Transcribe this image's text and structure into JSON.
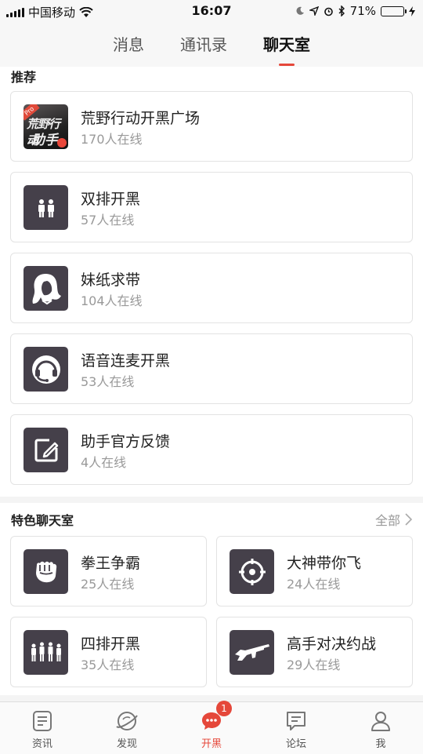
{
  "status_bar": {
    "carrier": "中国移动",
    "time": "16:07",
    "battery_percent": "71%",
    "battery_level": 0.71
  },
  "top_tabs": [
    {
      "label": "消息",
      "active": false
    },
    {
      "label": "通讯录",
      "active": false
    },
    {
      "label": "聊天室",
      "active": true
    }
  ],
  "recommend": {
    "title": "推荐",
    "items": [
      {
        "name": "荒野行动开黑广场",
        "count": "170人在线",
        "icon": "game-logo-icon",
        "logo_text_1": "荒野行动",
        "logo_text_2": "助手",
        "logo_badge": "Pro"
      },
      {
        "name": "双排开黑",
        "count": "57人在线",
        "icon": "two-players-icon"
      },
      {
        "name": "妹纸求带",
        "count": "104人在线",
        "icon": "girl-portrait-icon"
      },
      {
        "name": "语音连麦开黑",
        "count": "53人在线",
        "icon": "headset-icon"
      },
      {
        "name": "助手官方反馈",
        "count": "4人在线",
        "icon": "edit-feedback-icon"
      }
    ]
  },
  "featured": {
    "title": "特色聊天室",
    "more_label": "全部",
    "items": [
      {
        "name": "拳王争霸",
        "count": "25人在线",
        "icon": "fist-icon"
      },
      {
        "name": "大神带你飞",
        "count": "24人在线",
        "icon": "crosshair-icon"
      },
      {
        "name": "四排开黑",
        "count": "35人在线",
        "icon": "four-players-icon"
      },
      {
        "name": "高手对决约战",
        "count": "29人在线",
        "icon": "rifle-icon"
      }
    ]
  },
  "bottom_tabs": [
    {
      "label": "资讯",
      "icon": "news-icon",
      "active": false
    },
    {
      "label": "发现",
      "icon": "planet-icon",
      "active": false
    },
    {
      "label": "开黑",
      "icon": "chat-bubble-icon",
      "active": true,
      "badge": "1"
    },
    {
      "label": "论坛",
      "icon": "forum-icon",
      "active": false
    },
    {
      "label": "我",
      "icon": "user-icon",
      "active": false
    }
  ],
  "colors": {
    "accent": "#e5473a",
    "icon_bg": "#45404a",
    "battery": "#3bd14f"
  }
}
